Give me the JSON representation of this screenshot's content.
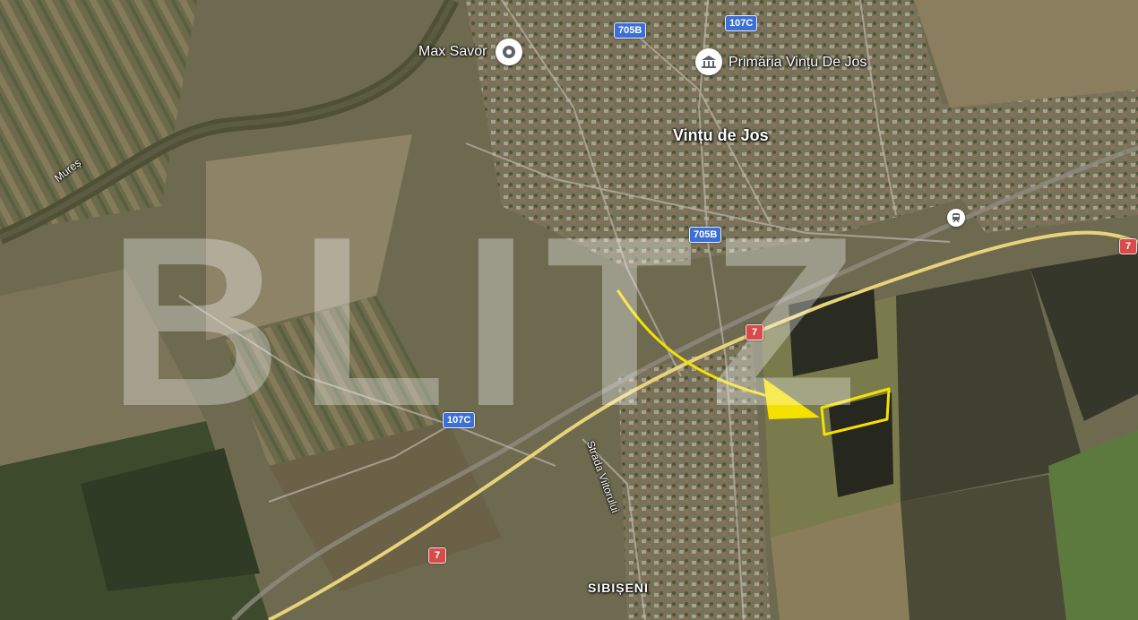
{
  "map": {
    "type": "satellite",
    "watermark": "BLITZ",
    "places": {
      "town": "Vințu de Jos",
      "village": "SIBIȘENI",
      "river": "Mureș",
      "street": "Strada Viitorului"
    },
    "pois": [
      {
        "name": "Max Savor",
        "icon": "location-pin-icon"
      },
      {
        "name": "Primăria Vințu De Jos",
        "icon": "town-hall-icon"
      }
    ],
    "road_shields": {
      "r705b_top": "705B",
      "r107c_top": "107C",
      "r705b_mid": "705B",
      "r107c_mid": "107C",
      "r7_east": "7",
      "r7_mid": "7",
      "r7_south": "7"
    },
    "colors": {
      "annotation": "#f5e100",
      "county_road_shield": "#3b6fd6",
      "national_road_shield": "#d94a4a",
      "national_road": "#e8d27a"
    },
    "annotation": {
      "kind": "arrow-and-outline",
      "target": "highlighted parcel"
    },
    "icons": {
      "transit": "train-station-icon"
    }
  }
}
